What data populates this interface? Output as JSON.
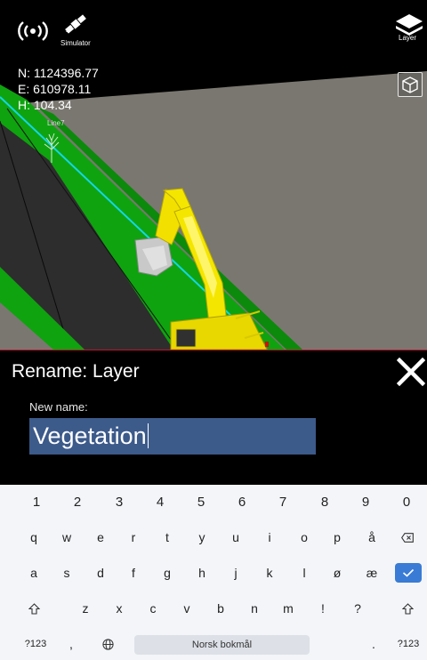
{
  "status": {
    "simulator_label": "Simulator",
    "layer_label": "Layer"
  },
  "coordinates": {
    "n": "N: 1124396.77",
    "e": "E: 610978.11",
    "h": "H: 104.34"
  },
  "scene": {
    "line_label": "Line7"
  },
  "dialog": {
    "title": "Rename: Layer",
    "field_label": "New name:",
    "field_value": "Vegetation"
  },
  "keyboard": {
    "number_row": [
      "1",
      "2",
      "3",
      "4",
      "5",
      "6",
      "7",
      "8",
      "9",
      "0"
    ],
    "row1": [
      "q",
      "w",
      "e",
      "r",
      "t",
      "y",
      "u",
      "i",
      "o",
      "p",
      "å"
    ],
    "row2": [
      "a",
      "s",
      "d",
      "f",
      "g",
      "h",
      "j",
      "k",
      "l",
      "ø",
      "æ"
    ],
    "row3": [
      "z",
      "x",
      "c",
      "v",
      "b",
      "n",
      "m",
      "!",
      "?"
    ],
    "symbols_key": "?123",
    "comma_key": ",",
    "period_key": ".",
    "space_label": "Norsk bokmål",
    "symbols_key_right": "?123"
  },
  "colors": {
    "selection": "#3c5a8a",
    "enter_key": "#3a7bd5",
    "dialog_border": "#c8102e",
    "grass": "#0fa30f",
    "machine": "#f5e600"
  }
}
